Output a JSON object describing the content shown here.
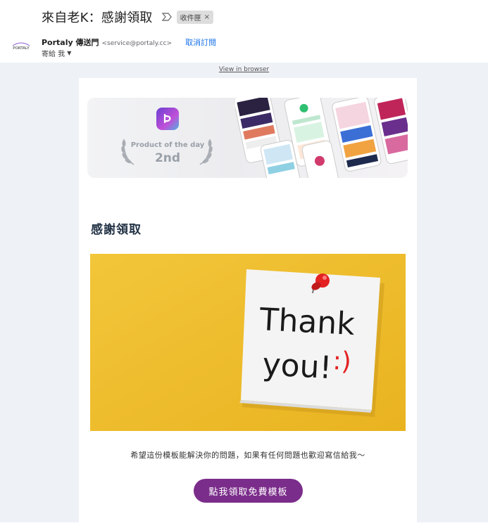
{
  "email": {
    "subject": "來自老K：感謝領取",
    "label": "收件匣",
    "label_remove": "×",
    "sender_name": "Portaly 傳送門",
    "sender_email": "<service@portaly.cc>",
    "unsubscribe": "取消訂閱",
    "to_line": "寄給 我",
    "avatar_logo_text": "PORTALY"
  },
  "body": {
    "view_in_browser": "View in browser",
    "banner": {
      "award_label": "Product of the day",
      "award_rank": "2nd"
    },
    "title": "感謝領取",
    "image": {
      "note_line1": "Thank",
      "note_line2": "you!",
      "smiley": ":)"
    },
    "message": "希望這份模板能解決你的問題，如果有任何問題也歡迎寫信給我～",
    "cta_label": "點我領取免費模板"
  },
  "colors": {
    "cta": "#7b2d8b",
    "link": "#1a73e8",
    "background": "#eef1f6",
    "image_background": "#f2c12e",
    "pin": "#e32222"
  },
  "icons": {
    "important": "important-marker-icon",
    "caret": "chevron-down-icon"
  }
}
